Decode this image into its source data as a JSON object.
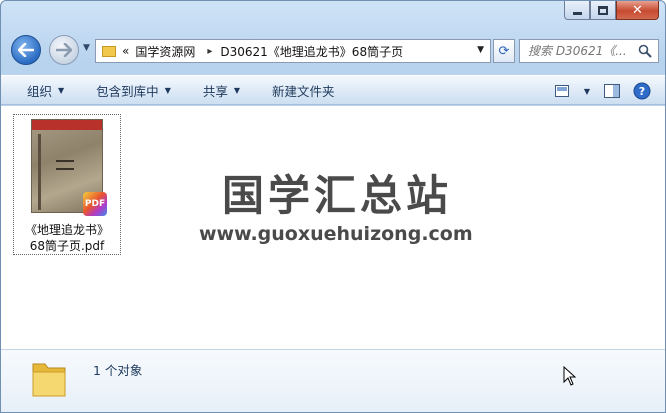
{
  "window": {
    "caption": {
      "minimize": "minimize",
      "maximize": "maximize",
      "close": "close"
    }
  },
  "navigation": {
    "back_tooltip": "Back",
    "forward_tooltip": "Forward"
  },
  "address_bar": {
    "overflow_chevron": "«",
    "separator": "▸",
    "crumbs": [
      "国学资源网",
      "D30621《地理追龙书》68筒子页"
    ]
  },
  "search": {
    "placeholder": "搜索 D30621《..."
  },
  "toolbar": {
    "organize": "组织",
    "include_in_library": "包含到库中",
    "share": "共享",
    "new_folder": "新建文件夹"
  },
  "files": [
    {
      "name_line1": "《地理追龙书》",
      "name_line2": "68筒子页.pdf",
      "badge": "PDF"
    }
  ],
  "watermark": {
    "title": "国学汇总站",
    "url": "www.guoxuehuizong.com"
  },
  "details": {
    "count_text": "1 个对象"
  },
  "colors": {
    "accent": "#2b6cc4",
    "close_red": "#c74a30",
    "folder_yellow": "#f1c84b"
  }
}
